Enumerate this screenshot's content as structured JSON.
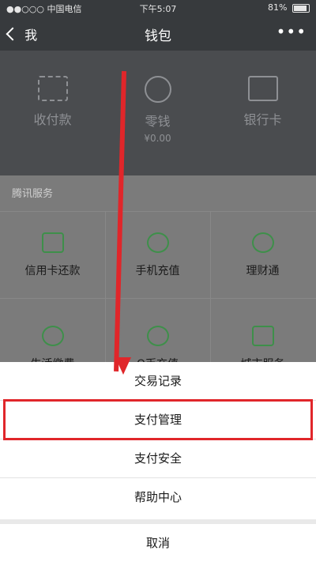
{
  "status": {
    "carrier": "●●○○○ 中国电信",
    "time": "下午5:07",
    "battery": "81%"
  },
  "nav": {
    "back_label": "我",
    "title": "钱包",
    "more": "•••"
  },
  "wallet": {
    "items": [
      {
        "label": "收付款"
      },
      {
        "label": "零钱",
        "sub": "¥0.00"
      },
      {
        "label": "银行卡"
      }
    ]
  },
  "services": {
    "header": "腾讯服务",
    "items": [
      {
        "label": "信用卡还款"
      },
      {
        "label": "手机充值"
      },
      {
        "label": "理财通"
      },
      {
        "label": "生活缴费"
      },
      {
        "label": "Q币充值"
      },
      {
        "label": "城市服务"
      }
    ]
  },
  "sheet": {
    "options": [
      "交易记录",
      "支付管理",
      "支付安全",
      "帮助中心"
    ],
    "cancel": "取消"
  }
}
